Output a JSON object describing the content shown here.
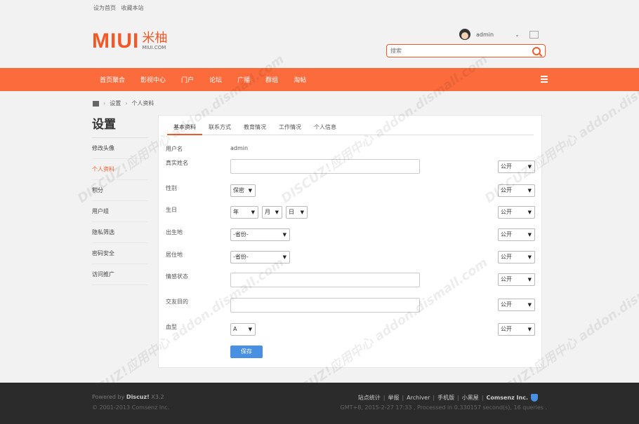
{
  "topbar": {
    "set_home": "设为首页",
    "bookmark": "收藏本站"
  },
  "logo": {
    "brand": "MIUI",
    "cn": "米柚",
    "domain": "MIUI.COM"
  },
  "user": {
    "name": "admin",
    "caret": "⌄"
  },
  "search": {
    "placeholder": "搜索"
  },
  "nav": {
    "items": [
      "首页聚合",
      "影视中心",
      "门户",
      "论坛",
      "广播",
      "群组",
      "淘帖"
    ]
  },
  "breadcrumb": {
    "settings": "设置",
    "current": "个人资料",
    "sep": "›"
  },
  "sidebar": {
    "title": "设置",
    "items": [
      "修改头像",
      "个人资料",
      "积分",
      "用户组",
      "隐私筛选",
      "密码安全",
      "访问推广"
    ]
  },
  "tabs": [
    "基本资料",
    "联系方式",
    "教育情况",
    "工作情况",
    "个人信息"
  ],
  "form": {
    "username_label": "用户名",
    "username_value": "admin",
    "realname_label": "真实姓名",
    "gender_label": "性别",
    "gender_value": "保密",
    "birthday_label": "生日",
    "year": "年",
    "month": "月",
    "day": "日",
    "birthplace_label": "出生地",
    "residence_label": "居住地",
    "province_placeholder": "-省份-",
    "affective_label": "情感状态",
    "lookingfor_label": "交友目的",
    "bloodtype_label": "血型",
    "bloodtype_value": "A",
    "privacy": "公开",
    "save": "保存"
  },
  "footer": {
    "powered": "Powered by",
    "discuz": "Discuz!",
    "version": "X3.2",
    "copyright": "© 2001-2013 Comsenz Inc.",
    "links": [
      "站点统计",
      "举报",
      "Archiver",
      "手机版",
      "小黑屋"
    ],
    "company": "Comsenz Inc.",
    "stats": "GMT+8, 2015-2-27 17:33 , Processed in 0.330157 second(s), 16 queries ."
  },
  "watermark": "DISCUZ!应用中心 addon.dismall.com",
  "colors": {
    "accent": "#fc6b3c",
    "brand": "#f05a28",
    "button": "#4a90e2",
    "footer": "#2b2b2b"
  }
}
